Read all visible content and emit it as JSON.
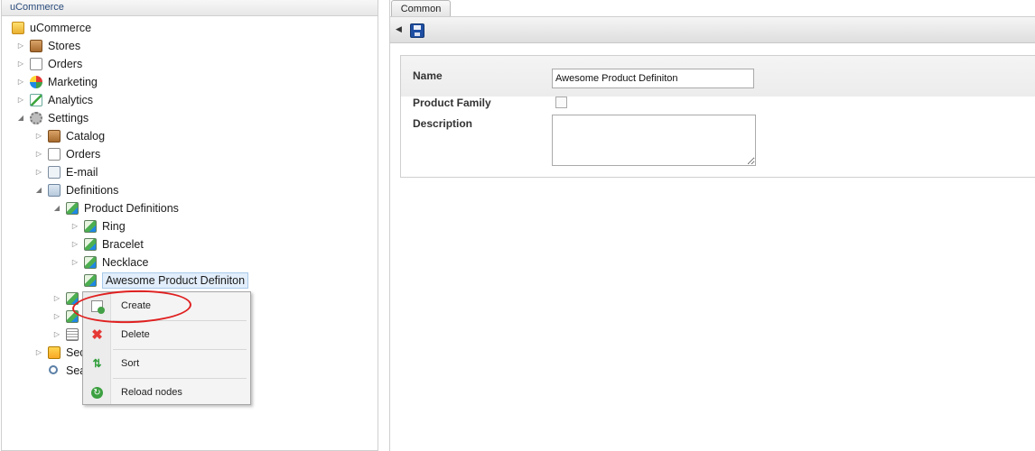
{
  "tree": {
    "header": "uCommerce",
    "root": "uCommerce",
    "items": {
      "stores": "Stores",
      "orders": "Orders",
      "marketing": "Marketing",
      "analytics": "Analytics",
      "settings": "Settings",
      "catalog": "Catalog",
      "settings_orders": "Orders",
      "email": "E-mail",
      "definitions": "Definitions",
      "product_definitions": "Product Definitions",
      "ring": "Ring",
      "bracelet": "Bracelet",
      "necklace": "Necklace",
      "awesome": "Awesome Product Definiton",
      "security_partial": "Sec",
      "search_partial": "Sea"
    }
  },
  "context_menu": {
    "items": [
      "Create",
      "Delete",
      "Sort",
      "Reload nodes"
    ],
    "annotation": "red hand-drawn circle around Create"
  },
  "editor": {
    "tab": "Common",
    "form": {
      "name_label": "Name",
      "name_value": "Awesome Product Definiton",
      "family_label": "Product Family",
      "family_checked": false,
      "description_label": "Description",
      "description_value": ""
    }
  },
  "icons": {
    "root": "folder-icon",
    "stores": "box-icon",
    "orders": "document-icon",
    "marketing": "globe-icon",
    "analytics": "chart-icon",
    "settings": "gear-icon",
    "definitions": "definitions-icon",
    "product_definition": "image-icon",
    "security": "lock-icon",
    "search": "search-icon",
    "save": "floppy-disk-icon",
    "create": "create-icon",
    "delete": "delete-icon",
    "sort": "sort-icon",
    "reload": "reload-icon"
  },
  "colors": {
    "annotation": "#e02020",
    "selection_bg": "#e2eefb",
    "save_icon": "#1f4fa3"
  }
}
